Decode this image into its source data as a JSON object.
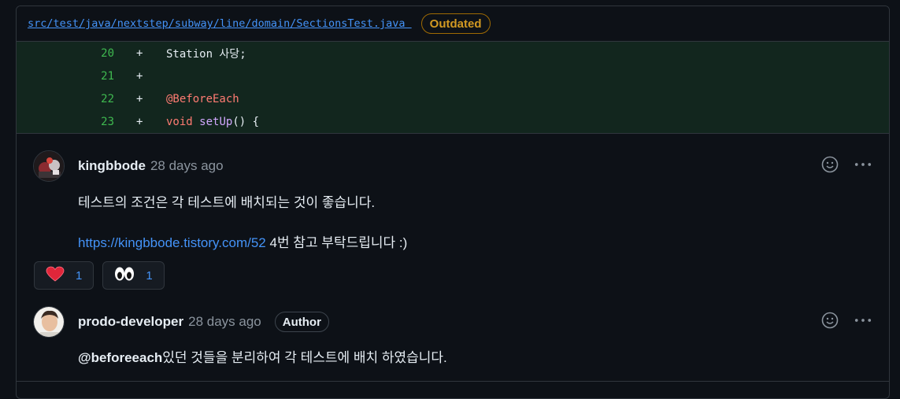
{
  "file": {
    "path": "src/test/java/nextstep/subway/line/domain/SectionsTest.java ",
    "badge": "Outdated"
  },
  "diff": {
    "lines": [
      {
        "number": "20",
        "sign": "+",
        "code_parts": [
          "Station 사당;"
        ]
      },
      {
        "number": "21",
        "sign": "+",
        "code_parts": [
          ""
        ]
      },
      {
        "number": "22",
        "sign": "+",
        "code_parts": [
          "@BeforeEach"
        ]
      },
      {
        "number": "23",
        "sign": "+",
        "code_parts": [
          "void",
          " ",
          "setUp",
          "() {"
        ]
      }
    ]
  },
  "comments": [
    {
      "author": "kingbbode",
      "time": "28 days ago",
      "body_line1": "테스트의 조건은 각 테스트에 배치되는 것이 좋습니다.",
      "link": "https://kingbbode.tistory.com/52",
      "body_line2_rest": " 4번 참고 부탁드립니다 :)",
      "reactions": [
        {
          "icon": "heart-icon",
          "count": "1"
        },
        {
          "icon": "eyes-icon",
          "count": "1"
        }
      ]
    },
    {
      "author": "prodo-developer",
      "time": "28 days ago",
      "badge": "Author",
      "mention": "@beforeeach",
      "body_rest": "있던 것들을 분리하여 각 테스트에 배치 하였습니다."
    }
  ],
  "colors": {
    "background": "#0d1117",
    "diff_added_bg": "#12261e",
    "line_number": "#3fb950",
    "link": "#4493f8",
    "outdated": "#d29922"
  }
}
